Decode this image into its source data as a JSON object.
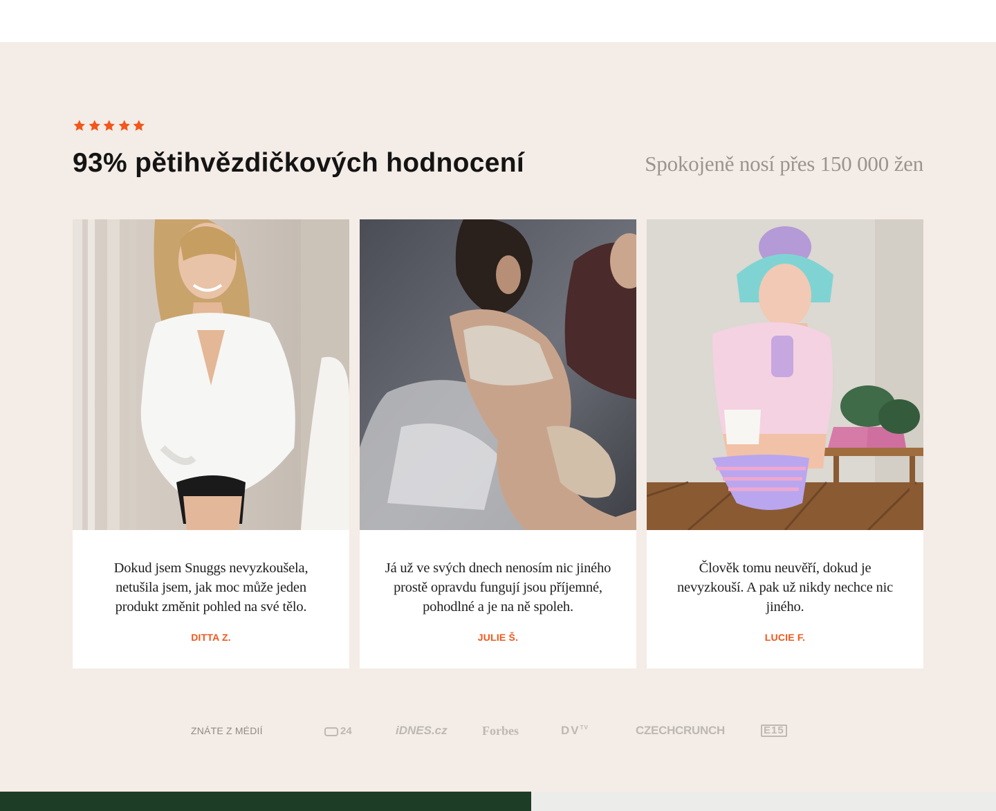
{
  "rating": {
    "stars": 5,
    "star_color": "#f2571b",
    "icon": "star-icon"
  },
  "heading": "93% pětihvězdičkových hodnocení",
  "subheading": "Spokojeně nosí přes 150 000 žen",
  "reviews": [
    {
      "quote": "Dokud jsem Snuggs nevyzkoušela, netušila jsem, jak moc může jeden produkt změnit pohled na své tělo.",
      "author": "DITTA Z.",
      "photo": "woman-white-shirt-black-underwear-photo"
    },
    {
      "quote": "Já už ve svých dnech nenosím nic jiného prostě opravdu fungují jsou příjemné, pohodlné a je na ně spoleh.",
      "author": "JULIE Š.",
      "photo": "woman-on-bed-with-child-photo"
    },
    {
      "quote": "Člověk tomu neuvěří, dokud je nevyzkouší. A pak už nikdy nechce nic jiného.",
      "author": "LUCIE F.",
      "photo": "woman-mirror-selfie-pastel-hair-photo"
    }
  ],
  "media": {
    "label": "ZNÁTE Z MÉDIÍ",
    "logos": {
      "ct24": "24",
      "idnes": "iDNES.cz",
      "forbes": "Forbes",
      "dvtv": "DV",
      "dvtv_sup": "TV",
      "czechcrunch": "CZECHCRUNCH",
      "e15": "E15"
    }
  },
  "colors": {
    "section_bg": "#f4ece6",
    "accent": "#f2571b",
    "footer_green": "#1d3d26"
  }
}
